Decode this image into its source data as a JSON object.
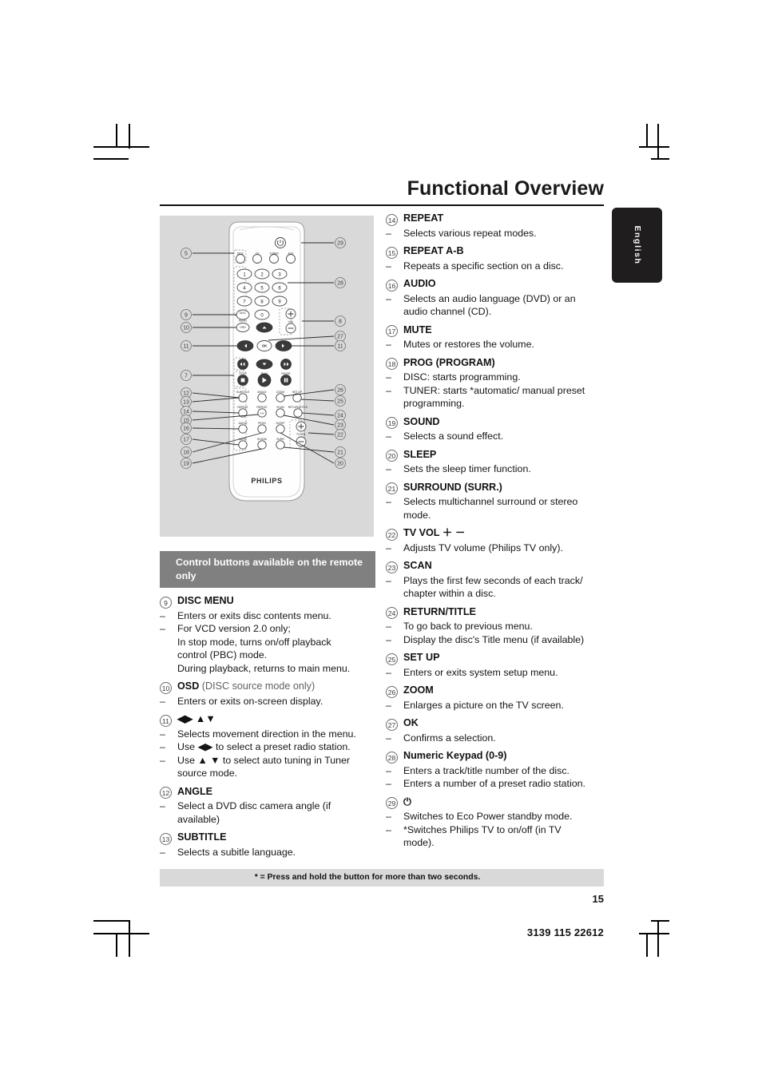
{
  "header": {
    "title": "Functional Overview",
    "language_tab": "English"
  },
  "figure": {
    "caption_alt": "philips-remote-control-diagram",
    "brand": "PHILIPS",
    "source_buttons": [
      "DISC",
      "TV",
      "TUNER",
      "AUX"
    ],
    "keypad": [
      "1",
      "2",
      "3",
      "4",
      "5",
      "6",
      "7",
      "8",
      "9",
      "0"
    ],
    "labels": {
      "disc_menu": "DISC MENU",
      "osd": "OSD",
      "vol": "VOL",
      "ok": "OK",
      "stop": "STOP",
      "play": "PLAY",
      "pause": "PAUSE",
      "subtitle": "SUBTITLE",
      "angle": "ANGLE",
      "zoom": "ZOOM",
      "setup": "SET UP",
      "repeat": "REPEAT",
      "repeat_ab": "REPEAT A-B",
      "scan": "SCAN",
      "return_title": "RETURN/TITLE",
      "audio": "AUDIO",
      "prog": "PROG",
      "sleep": "SLEEP",
      "tv_vol": "TV VOL",
      "mute": "MUTE",
      "sound": "SOUND",
      "surr": "SURR"
    },
    "callouts_left": [
      "5",
      "9",
      "10",
      "11",
      "7",
      "12",
      "13",
      "14",
      "15",
      "16",
      "17",
      "18",
      "19"
    ],
    "callouts_right": [
      "29",
      "28",
      "8",
      "27",
      "11",
      "26",
      "25",
      "24",
      "23",
      "22",
      "21",
      "20"
    ]
  },
  "left_column": {
    "band_title": "Control buttons available on the remote only",
    "entries": [
      {
        "num": "9",
        "title": "DISC MENU",
        "bullets": [
          "Enters or exits disc contents menu.",
          "For VCD version 2.0 only;"
        ],
        "continuations": [
          "In stop mode, turns on/off playback",
          "control (PBC) mode.",
          "During playback, returns to main menu."
        ]
      },
      {
        "num": "10",
        "title": "OSD",
        "title_sub": " (DISC source mode only)",
        "bullets": [
          "Enters or exits on-screen display."
        ],
        "continuations": []
      },
      {
        "num": "11",
        "title": "◀▶ ▲▼",
        "bullets": [
          "Selects movement direction in the menu.",
          "Use ◀▶ to select a preset radio station.",
          "Use ▲ ▼ to select auto tuning in Tuner"
        ],
        "continuations": [
          "source mode."
        ]
      },
      {
        "num": "12",
        "title": "ANGLE",
        "bullets": [
          "Select a DVD disc camera angle (if"
        ],
        "continuations": [
          "available)"
        ]
      },
      {
        "num": "13",
        "title": "SUBTITLE",
        "bullets": [
          "Selects a subitle language."
        ],
        "continuations": []
      }
    ]
  },
  "right_column": {
    "entries": [
      {
        "num": "14",
        "title": "REPEAT",
        "bullets": [
          "Selects various repeat modes."
        ],
        "continuations": []
      },
      {
        "num": "15",
        "title": "REPEAT A-B",
        "bullets": [
          "Repeats a specific section on a disc."
        ],
        "continuations": []
      },
      {
        "num": "16",
        "title": "AUDIO",
        "bullets": [
          "Selects an audio language (DVD) or an"
        ],
        "continuations": [
          "audio channel (CD)."
        ]
      },
      {
        "num": "17",
        "title": "MUTE",
        "bullets": [
          "Mutes or restores the volume."
        ],
        "continuations": []
      },
      {
        "num": "18",
        "title": "PROG (PROGRAM)",
        "bullets": [
          "DISC: starts programming.",
          "TUNER: starts *automatic/ manual preset"
        ],
        "continuations": [
          "programming."
        ]
      },
      {
        "num": "19",
        "title": "SOUND",
        "bullets": [
          "Selects a sound effect."
        ],
        "continuations": []
      },
      {
        "num": "20",
        "title": "SLEEP",
        "bullets": [
          "Sets the sleep timer function."
        ],
        "continuations": []
      },
      {
        "num": "21",
        "title": "SURROUND (SURR.)",
        "bullets": [
          "Selects multichannel surround or stereo"
        ],
        "continuations": [
          "mode."
        ]
      },
      {
        "num": "22",
        "title": "TV VOL ＋ －",
        "bullets": [
          "Adjusts TV volume (Philips TV only)."
        ],
        "continuations": []
      },
      {
        "num": "23",
        "title": "SCAN",
        "bullets": [
          "Plays the first few seconds of each track/"
        ],
        "continuations": [
          "chapter within a disc."
        ]
      },
      {
        "num": "24",
        "title": "RETURN/TITLE",
        "bullets": [
          "To go back to previous menu.",
          "Display the disc's Title menu (if available)"
        ],
        "continuations": []
      },
      {
        "num": "25",
        "title": "SET UP",
        "bullets": [
          "Enters or exits system setup menu."
        ],
        "continuations": []
      },
      {
        "num": "26",
        "title": "ZOOM",
        "bullets": [
          "Enlarges a picture on the TV screen."
        ],
        "continuations": []
      },
      {
        "num": "27",
        "title": "OK",
        "bullets": [
          "Confirms a selection."
        ],
        "continuations": []
      },
      {
        "num": "28",
        "title": "Numeric Keypad (0-9)",
        "bullets": [
          "Enters a track/title number of the disc.",
          "Enters a number of a preset radio station."
        ],
        "continuations": []
      },
      {
        "num": "29",
        "title": "⏻",
        "bullets": [
          "Switches to Eco Power standby mode.",
          "*Switches Philips TV to on/off (in TV"
        ],
        "continuations": [
          "mode)."
        ]
      }
    ]
  },
  "footer": {
    "footnote": "* = Press and hold the button for more than two seconds.",
    "page_number": "15",
    "doc_code": "3139 115 22612"
  }
}
